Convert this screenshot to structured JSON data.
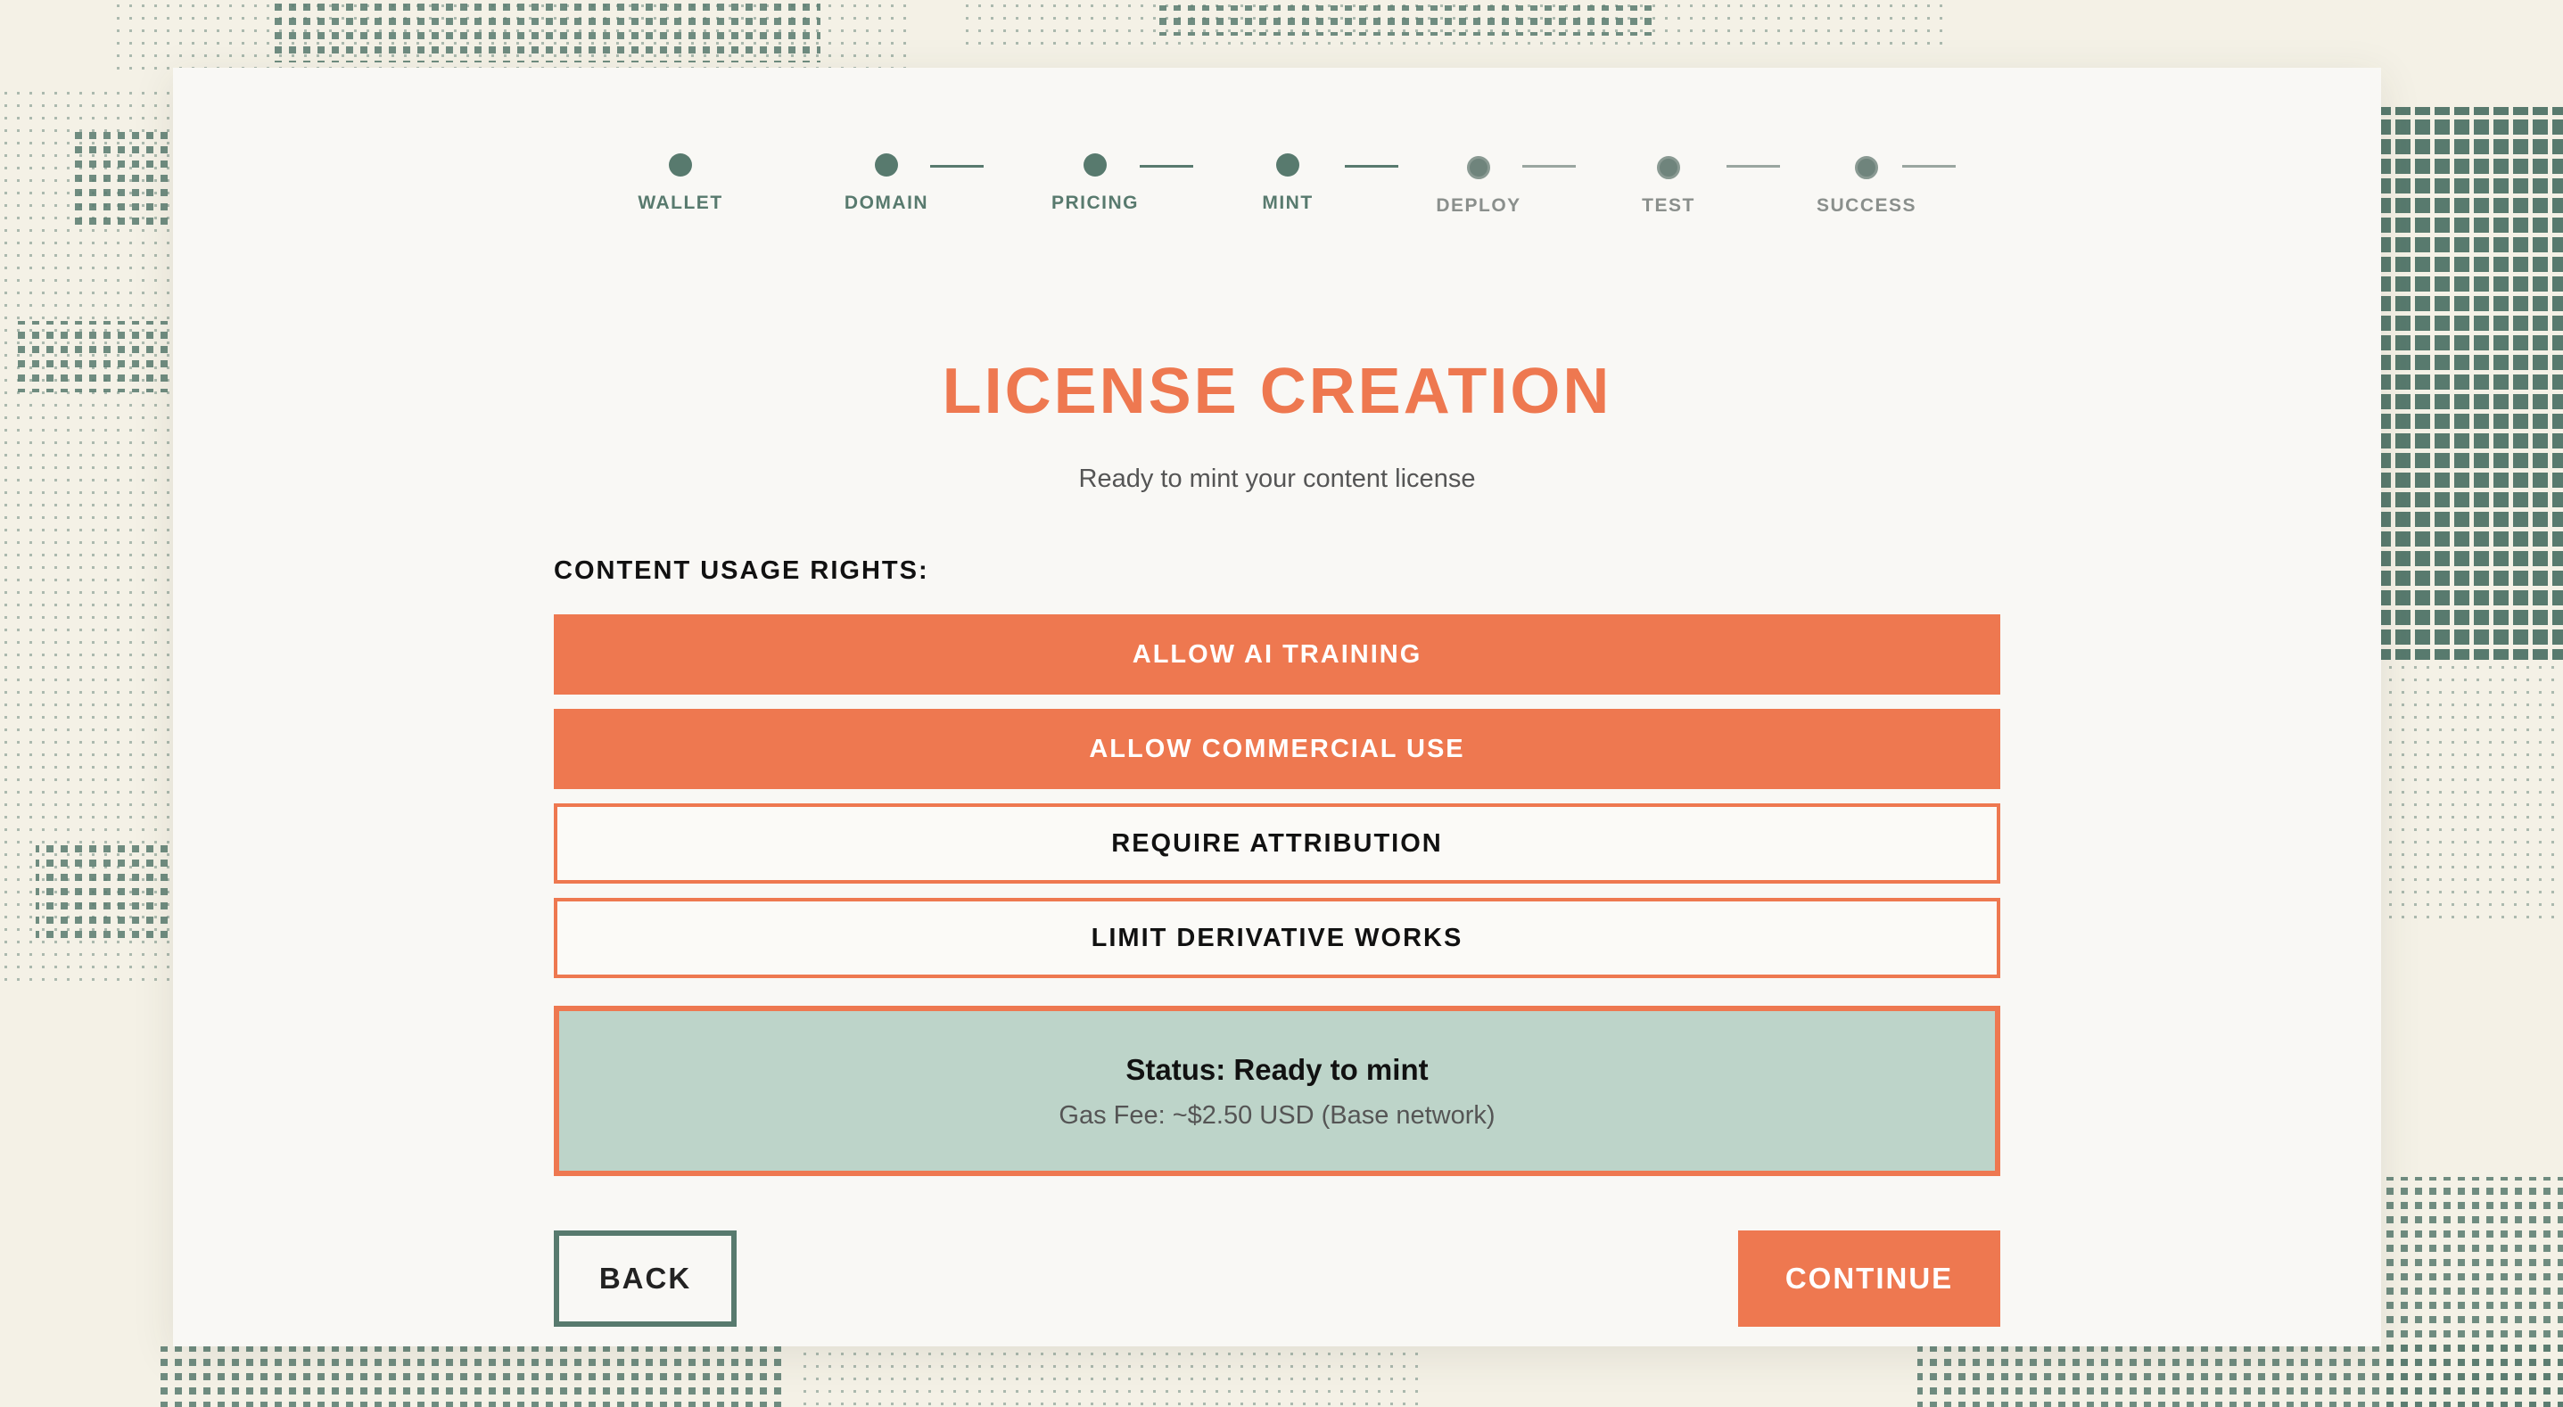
{
  "colors": {
    "accent": "#ee7850",
    "primary": "#587a6e",
    "status_bg": "#bdd4c9",
    "card_bg": "#f9f8f5",
    "page_bg": "#f4f1e6"
  },
  "stepper": {
    "steps": [
      {
        "label": "WALLET",
        "state": "complete"
      },
      {
        "label": "DOMAIN",
        "state": "complete"
      },
      {
        "label": "PRICING",
        "state": "complete"
      },
      {
        "label": "MINT",
        "state": "current"
      },
      {
        "label": "DEPLOY",
        "state": "pending"
      },
      {
        "label": "TEST",
        "state": "pending"
      },
      {
        "label": "SUCCESS",
        "state": "pending"
      }
    ]
  },
  "header": {
    "title": "LICENSE CREATION",
    "subtitle": "Ready to mint your content license"
  },
  "rights": {
    "section_label": "CONTENT USAGE RIGHTS:",
    "options": [
      {
        "label": "ALLOW AI TRAINING",
        "selected": true
      },
      {
        "label": "ALLOW COMMERCIAL USE",
        "selected": true
      },
      {
        "label": "REQUIRE ATTRIBUTION",
        "selected": false
      },
      {
        "label": "LIMIT DERIVATIVE WORKS",
        "selected": false
      }
    ]
  },
  "status": {
    "title": "Status: Ready to mint",
    "fee": "Gas Fee: ~$2.50 USD (Base network)"
  },
  "actions": {
    "back_label": "BACK",
    "continue_label": "CONTINUE"
  }
}
